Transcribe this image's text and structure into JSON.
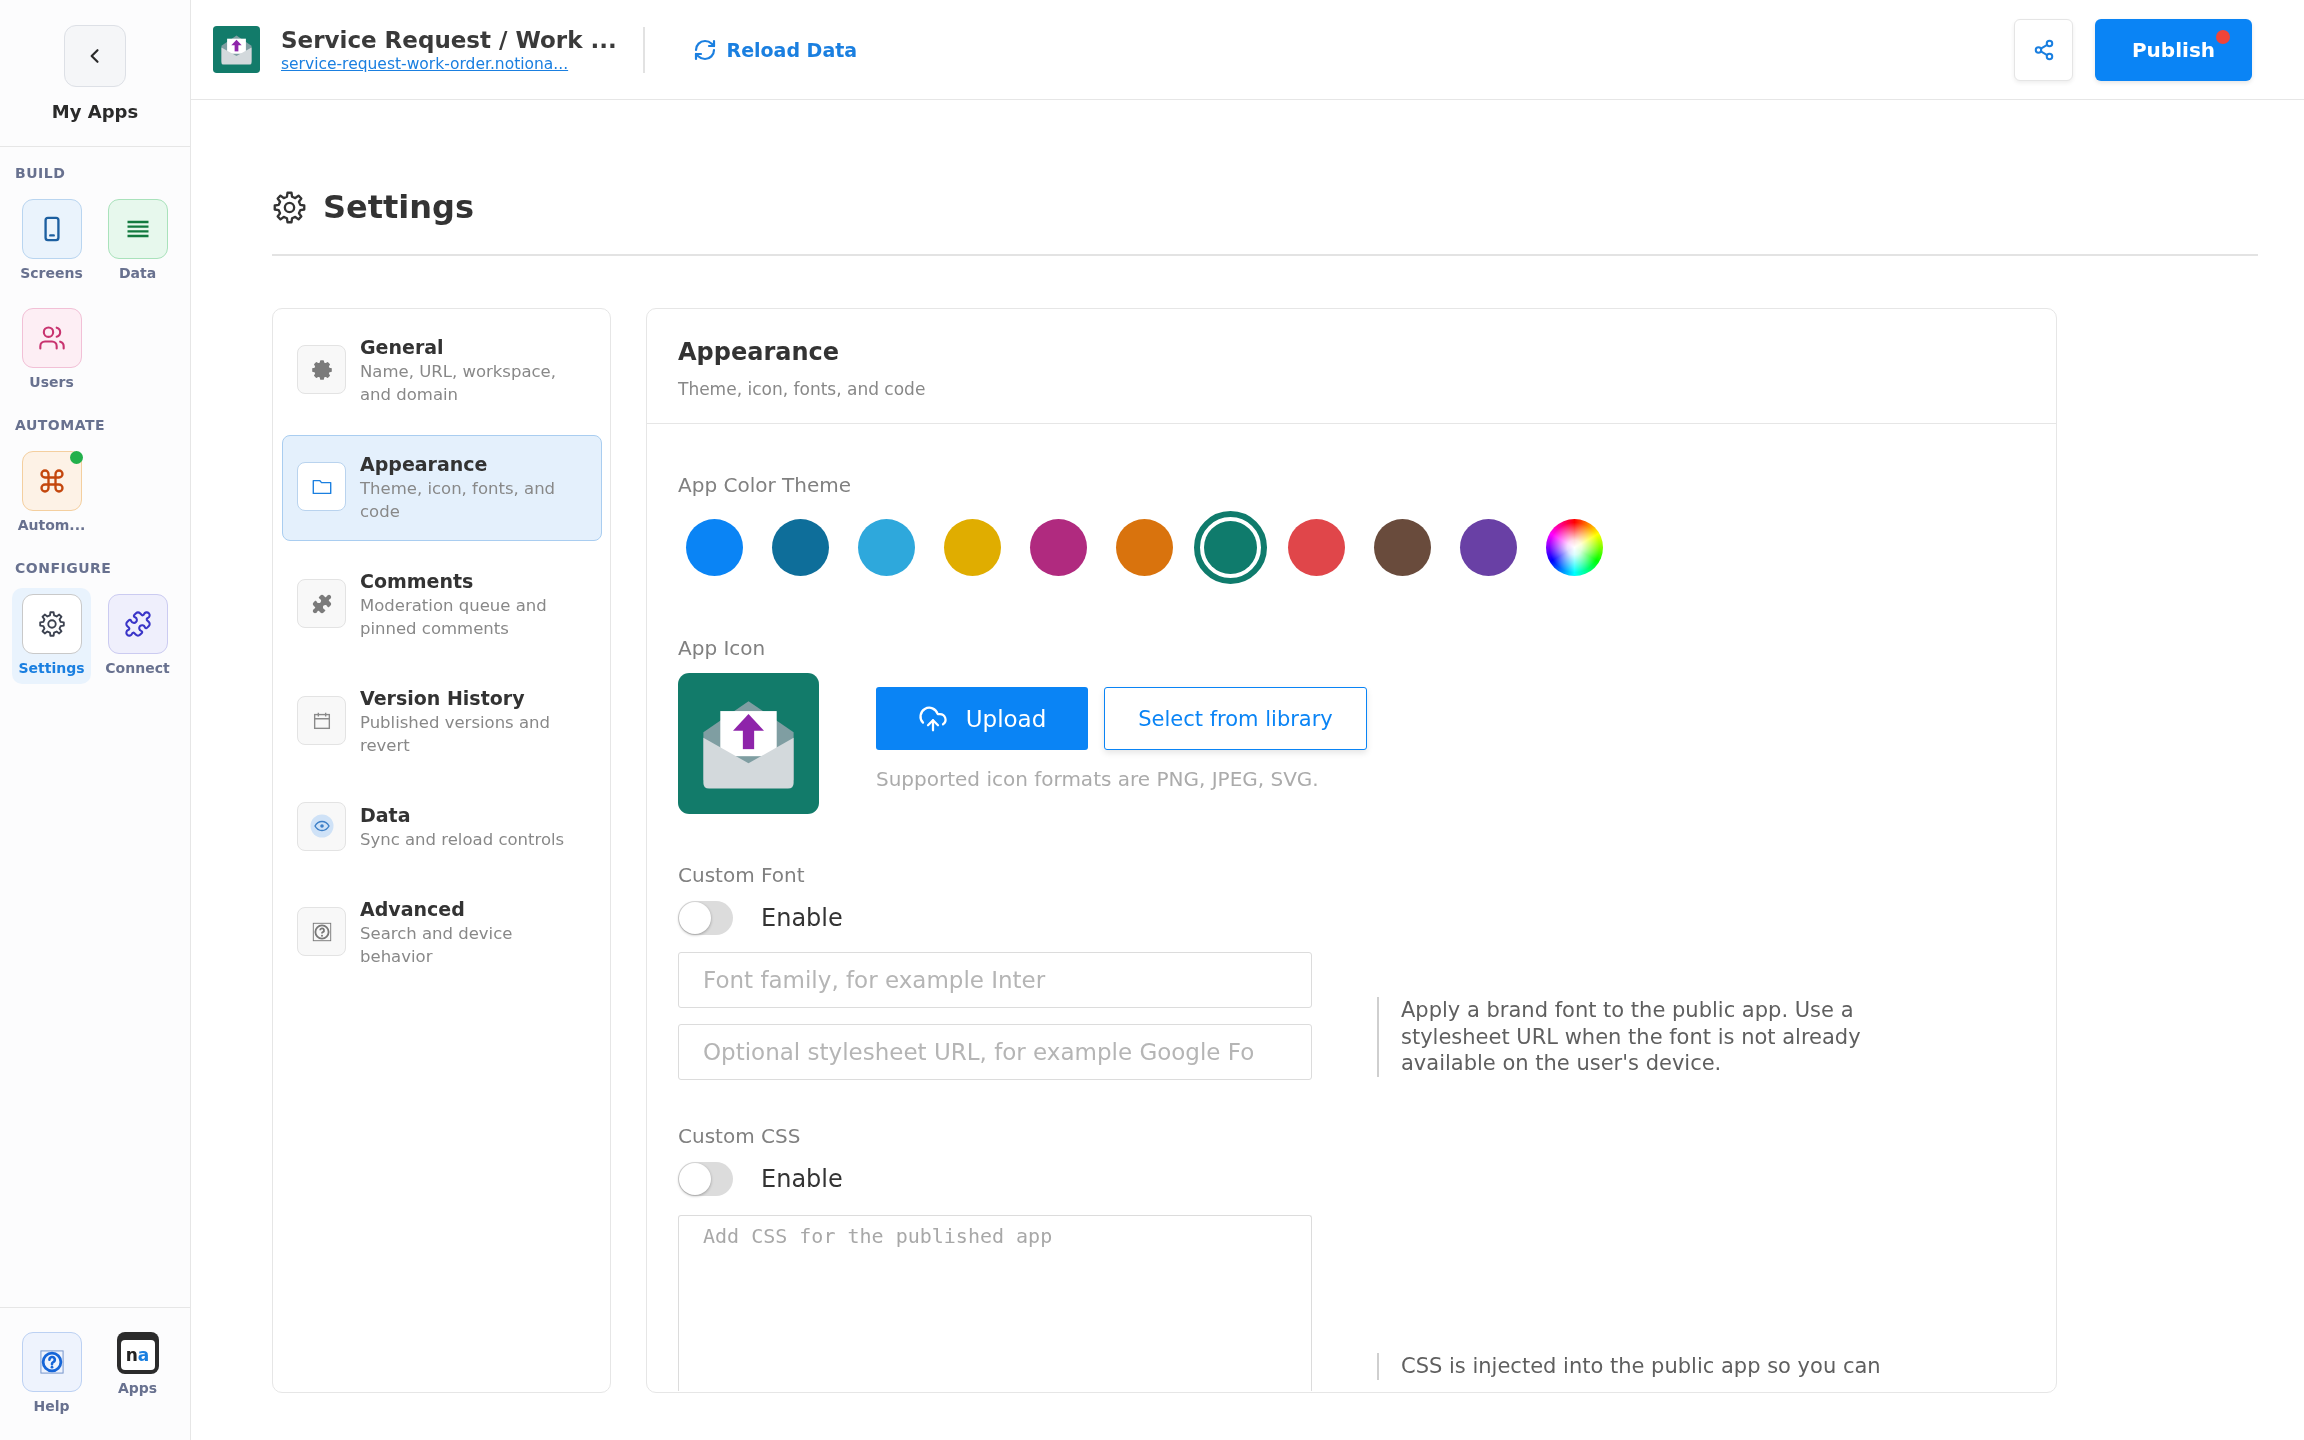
{
  "sidebar": {
    "title": "My Apps",
    "sections": [
      {
        "title": "BUILD",
        "items": [
          {
            "label": "Screens",
            "kind": "screens",
            "selected": false,
            "alert": false
          },
          {
            "label": "Data",
            "kind": "data",
            "selected": false,
            "alert": false
          },
          {
            "label": "Users",
            "kind": "users",
            "selected": false,
            "alert": false
          }
        ]
      },
      {
        "title": "AUTOMATE",
        "items": [
          {
            "label": "Autom...",
            "kind": "automations",
            "selected": false,
            "alert": true
          }
        ]
      },
      {
        "title": "CONFIGURE",
        "items": [
          {
            "label": "Settings",
            "kind": "settings",
            "selected": true,
            "alert": false
          },
          {
            "label": "Connect",
            "kind": "connect",
            "selected": false,
            "alert": false
          }
        ]
      }
    ],
    "footer": [
      {
        "label": "Help",
        "kind": "help"
      },
      {
        "label": "Apps",
        "kind": "apps",
        "logo": [
          {
            "text": "n",
            "accent": false
          },
          {
            "text": "a",
            "accent": true
          }
        ]
      }
    ]
  },
  "topbar": {
    "app_title": "Service Request / Work ...",
    "app_url": "service-request-work-order.notiona...",
    "reload_label": "Reload Data",
    "publish": {
      "label": "Publish",
      "unpublished_changes": true
    }
  },
  "settings": {
    "title": "Settings",
    "nav": [
      {
        "title": "General",
        "description": "Name, URL, workspace, and domain",
        "kind": "general",
        "selected": false
      },
      {
        "title": "Appearance",
        "description": "Theme, icon, fonts, and code",
        "kind": "appearance",
        "selected": true
      },
      {
        "title": "Comments",
        "description": "Moderation queue and pinned comments",
        "kind": "comments",
        "selected": false
      },
      {
        "title": "Version History",
        "description": "Published versions and revert",
        "kind": "versions",
        "selected": false
      },
      {
        "title": "Data",
        "description": "Sync and reload controls",
        "kind": "data",
        "selected": false
      },
      {
        "title": "Advanced",
        "description": "Search and device behavior",
        "kind": "advanced",
        "selected": false
      }
    ]
  },
  "appearance": {
    "title": "Appearance",
    "subtitle": "Theme, icon, fonts, and code",
    "color_theme": {
      "label": "App Color Theme",
      "swatches": [
        {
          "kind": "solid",
          "color": "#0a84f5",
          "selected": false
        },
        {
          "kind": "solid",
          "color": "#0e6e9a",
          "selected": false
        },
        {
          "kind": "solid",
          "color": "#2ea8dc",
          "selected": false
        },
        {
          "kind": "solid",
          "color": "#e0ad00",
          "selected": false
        },
        {
          "kind": "solid",
          "color": "#b02a7f",
          "selected": false
        },
        {
          "kind": "solid",
          "color": "#d9730d",
          "selected": false
        },
        {
          "kind": "solid",
          "color": "#0f7b6c",
          "selected": true
        },
        {
          "kind": "solid",
          "color": "#e0464a",
          "selected": false
        },
        {
          "kind": "solid",
          "color": "#694b3c",
          "selected": false
        },
        {
          "kind": "solid",
          "color": "#6940a5",
          "selected": false
        },
        {
          "kind": "custom",
          "selected": false
        }
      ]
    },
    "app_icon": {
      "label": "App Icon",
      "upload_label": "Upload",
      "library_label": "Select from library",
      "hint": "Supported icon formats are PNG, JPEG, SVG."
    },
    "custom_font": {
      "label": "Custom Font",
      "toggle": {
        "label": "Enable",
        "on": false
      },
      "fields": [
        {
          "placeholder": "Font family, for example Inter"
        },
        {
          "placeholder": "Optional stylesheet URL, for example Google Fo"
        }
      ],
      "help": "Apply a brand font to the public app. Use a stylesheet URL when the font is not already available on the user's device."
    },
    "custom_css": {
      "label": "Custom CSS",
      "toggle": {
        "label": "Enable",
        "on": false
      },
      "editor": {
        "placeholder": "Add CSS for the published app"
      },
      "help": "CSS is injected into the public app so you can"
    }
  }
}
